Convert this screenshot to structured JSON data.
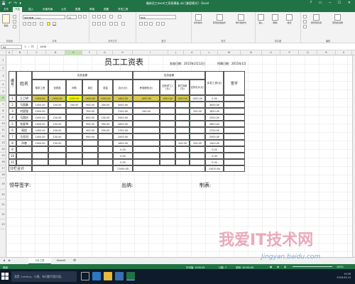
{
  "window": {
    "title": "最新员工excel工资表模板.xls [兼容模式] - Excel",
    "controls": [
      "?",
      "▭",
      "─",
      "☐",
      "✕"
    ]
  },
  "ribbon_tabs": [
    "文件",
    "开始",
    "插入",
    "页面布局",
    "公式",
    "数据",
    "审阅",
    "视图",
    "开发工具"
  ],
  "ribbon_tabs_active": 1,
  "ribbon": {
    "font_name": "微软雅黑 Light",
    "font_size": "11",
    "number_format": "数值",
    "group_labels": [
      "剪贴板",
      "字体",
      "对齐方式",
      "数字",
      "样式",
      "单元格",
      "编辑"
    ],
    "buttons": {
      "paste": "粘贴",
      "conditional_format": "条件格式",
      "table_format": "套用表格格式",
      "cell_style": "单元格样式",
      "insert": "插入",
      "delete": "删除",
      "format": "格式",
      "sort_filter": "排序和筛选",
      "find_select": "查找和选择"
    }
  },
  "formula_bar": {
    "name_box": "E6",
    "fx": "fx",
    "value": "1450"
  },
  "columns": [
    "A",
    "B",
    "C",
    "D",
    "E",
    "F",
    "G",
    "H",
    "I",
    "J",
    "K",
    "L",
    "M",
    "N",
    "O",
    "P",
    "Q",
    "R",
    "S"
  ],
  "selected_column": "E",
  "rows": [
    "1",
    "2",
    "3",
    "4",
    "5",
    "6",
    "7",
    "8",
    "9",
    "10",
    "11",
    "12",
    "13",
    "14",
    "15",
    "16",
    "17",
    "18",
    "19",
    "20",
    "21",
    "22",
    "23"
  ],
  "selected_row": "6",
  "sheet": {
    "title": "员工工资表",
    "issue_date": "发放日期：2015年2月12日",
    "period": "所属日期：2015年1月",
    "headers": {
      "no": "编号",
      "name": "姓名",
      "payable": "应发金额",
      "deductions": "应扣金额",
      "net": "实发工资(元)",
      "signature": "签字",
      "basic": "基本工资",
      "full_attendance": "全勤奖",
      "subsidy": "补助",
      "post": "岗位",
      "bonus": "奖金",
      "total": "合计(元)",
      "social": "养老缺勤(元)",
      "absence": "迟到(旷工)(元)",
      "late": "其它扣款(元)",
      "deduct_total": "应扣合计(元)"
    },
    "rows": [
      {
        "no": "1",
        "name": "王卫明",
        "basic": "1450.00",
        "full": "1450.00",
        "subsidy": "1450.00",
        "post": "1450.00",
        "bonus": "1450.00",
        "total": "1450.00",
        "social": "1450.00",
        "absence": "1450.00",
        "late": "1450.00",
        "deduct": "1450.00",
        "net": "0.00"
      },
      {
        "no": "2",
        "name": "马国春",
        "basic": "1450.00",
        "full": "150.00",
        "subsidy": "200.00",
        "post": "900.00",
        "bonus": "300.00",
        "total": "3000.00",
        "social": "",
        "absence": "",
        "late": "",
        "deduct": "",
        "net": "3000.00"
      },
      {
        "no": "3",
        "name": "刘国强",
        "basic": "1450.00",
        "full": "",
        "subsidy": "",
        "post": "700.00",
        "bonus": "",
        "total": "2150.00",
        "social": "330.00",
        "absence": "",
        "late": "",
        "deduct": "330.00",
        "net": "1820.00"
      },
      {
        "no": "4",
        "name": "马国庆",
        "basic": "1450.00",
        "full": "150.00",
        "subsidy": "",
        "post": "800.00",
        "bonus": "100.00",
        "total": "2500.00",
        "social": "",
        "absence": "",
        "late": "",
        "deduct": "",
        "net": "2500.00"
      },
      {
        "no": "5",
        "name": "张爱琴",
        "basic": "1450.00",
        "full": "150.00",
        "subsidy": "",
        "post": "900.00",
        "bonus": "300.00",
        "total": "2800.00",
        "social": "",
        "absence": "",
        "late": "",
        "deduct": "",
        "net": "2800.00"
      },
      {
        "no": "6",
        "name": "高阳",
        "basic": "1450.00",
        "full": "150.00",
        "subsidy": "",
        "post": "900.00",
        "bonus": "200.00",
        "total": "2700.00",
        "social": "",
        "absence": "",
        "late": "",
        "deduct": "",
        "net": "2700.00"
      },
      {
        "no": "7",
        "name": "马亚田",
        "basic": "1450.00",
        "full": "150.00",
        "subsidy": "",
        "post": "900.00",
        "bonus": "",
        "total": "2500.00",
        "social": "",
        "absence": "",
        "late": "",
        "deduct": "",
        "net": "2500.00"
      },
      {
        "no": "8",
        "name": "邓睿",
        "basic": "1450.00",
        "full": "150.00",
        "subsidy": "",
        "post": "",
        "bonus": "",
        "total": "1600.00",
        "social": "",
        "absence": "",
        "late": "200.00",
        "deduct": "200.00",
        "net": "1400.00"
      },
      {
        "no": "9",
        "name": "",
        "basic": "",
        "full": "",
        "subsidy": "",
        "post": "",
        "bonus": "",
        "total": "0.00",
        "social": "",
        "absence": "",
        "late": "",
        "deduct": "",
        "net": "0.00"
      },
      {
        "no": "10",
        "name": "",
        "basic": "",
        "full": "",
        "subsidy": "",
        "post": "",
        "bonus": "",
        "total": "0.00",
        "social": "",
        "absence": "",
        "late": "",
        "deduct": "",
        "net": "0.00"
      },
      {
        "no": "11",
        "name": "",
        "basic": "",
        "full": "",
        "subsidy": "",
        "post": "",
        "bonus": "",
        "total": "0.00",
        "social": "",
        "absence": "",
        "late": "",
        "deduct": "",
        "net": "0.00"
      }
    ],
    "subtotal_label": "分栏合计",
    "subtotal_total": "17450.00",
    "subtotal_net": "15470.00",
    "footer_leader": "领导签字:",
    "footer_cashier": "出纳:",
    "footer_maker": "制表:"
  },
  "sheet_tabs": [
    "5月工资",
    "Sheet3"
  ],
  "sheet_tabs_active": 0,
  "status": {
    "left": "就绪",
    "average": "平均值: 1450.00",
    "count": "计数: 7",
    "sum": "求和: 10150.00",
    "zoom": "100%"
  },
  "taskbar": {
    "search_placeholder": "我是 Cortana，小娜。有问题尽管问我。",
    "time": "19:39",
    "date": "2016-03-14"
  },
  "watermark": {
    "cn": "我爱IT技术网",
    "url": "Jingyan.baidu.com"
  },
  "colors": {
    "excel_green": "#217346",
    "highlight_yellow": "#ffff00",
    "highlight_khaki": "#d6c94e",
    "taskbar": "#0d1b2a",
    "watermark_pink": "#e8a0b4",
    "watermark_blue": "#7aa7d6"
  }
}
